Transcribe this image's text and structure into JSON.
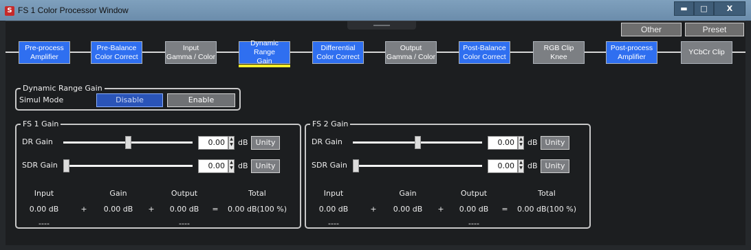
{
  "window": {
    "title": "FS 1 Color Processor Window",
    "icon": "app-icon",
    "minimize": "▬",
    "maximize": "□",
    "close": "X"
  },
  "top_buttons": {
    "other": "Other",
    "preset": "Preset"
  },
  "pipeline": [
    {
      "line1": "Pre-process",
      "line2": "Amplifier",
      "state": "blue"
    },
    {
      "line1": "Pre-Balance",
      "line2": "Color Correct",
      "state": "blue"
    },
    {
      "line1": "Input",
      "line2": "Gamma / Color",
      "state": "gray"
    },
    {
      "line1": "Dynamic Range",
      "line2": "Gain",
      "state": "blue",
      "selected": true
    },
    {
      "line1": "Differential",
      "line2": "Color Correct",
      "state": "blue"
    },
    {
      "line1": "Output",
      "line2": "Gamma / Color",
      "state": "gray"
    },
    {
      "line1": "Post-Balance",
      "line2": "Color Correct",
      "state": "blue"
    },
    {
      "line1": "RGB Clip",
      "line2": "Knee",
      "state": "gray"
    },
    {
      "line1": "Post-process",
      "line2": "Amplifier",
      "state": "blue"
    },
    {
      "line1": "YCbCr Clip",
      "line2": "",
      "state": "gray"
    }
  ],
  "dynamic_range_gain": {
    "title": "Dynamic Range Gain",
    "simul_mode_label": "Simul Mode",
    "disable": "Disable",
    "enable": "Enable",
    "selected": "Enable"
  },
  "fs1": {
    "title": "FS 1 Gain",
    "dr_label": "DR  Gain",
    "dr_value": "0.00",
    "dr_slider": 0.5,
    "sdr_label": "SDR Gain",
    "sdr_value": "0.00",
    "sdr_slider": 0.0,
    "unit": "dB",
    "unity": "Unity",
    "headers": {
      "input": "Input",
      "gain": "Gain",
      "output": "Output",
      "total": "Total"
    },
    "input": "0.00 dB",
    "plus1": "+",
    "gain": "0.00 dB",
    "plus2": "+",
    "output": "0.00 dB",
    "equals": "=",
    "total": "0.00 dB(100 %)",
    "input_sub": "----",
    "output_sub": "----"
  },
  "fs2": {
    "title": "FS 2 Gain",
    "dr_label": "DR  Gain",
    "dr_value": "0.00",
    "dr_slider": 0.5,
    "sdr_label": "SDR Gain",
    "sdr_value": "0.00",
    "sdr_slider": 0.0,
    "unit": "dB",
    "unity": "Unity",
    "headers": {
      "input": "Input",
      "gain": "Gain",
      "output": "Output",
      "total": "Total"
    },
    "input": "0.00 dB",
    "plus1": "+",
    "gain": "0.00 dB",
    "plus2": "+",
    "output": "0.00 dB",
    "equals": "=",
    "total": "0.00 dB(100 %)",
    "input_sub": "----",
    "output_sub": "----"
  },
  "colors": {
    "accent_blue": "#2f6ff0",
    "stage_gray": "#7c7f83",
    "selected_underline": "#f4ee2a",
    "titlebar": "#7fa0bd"
  }
}
